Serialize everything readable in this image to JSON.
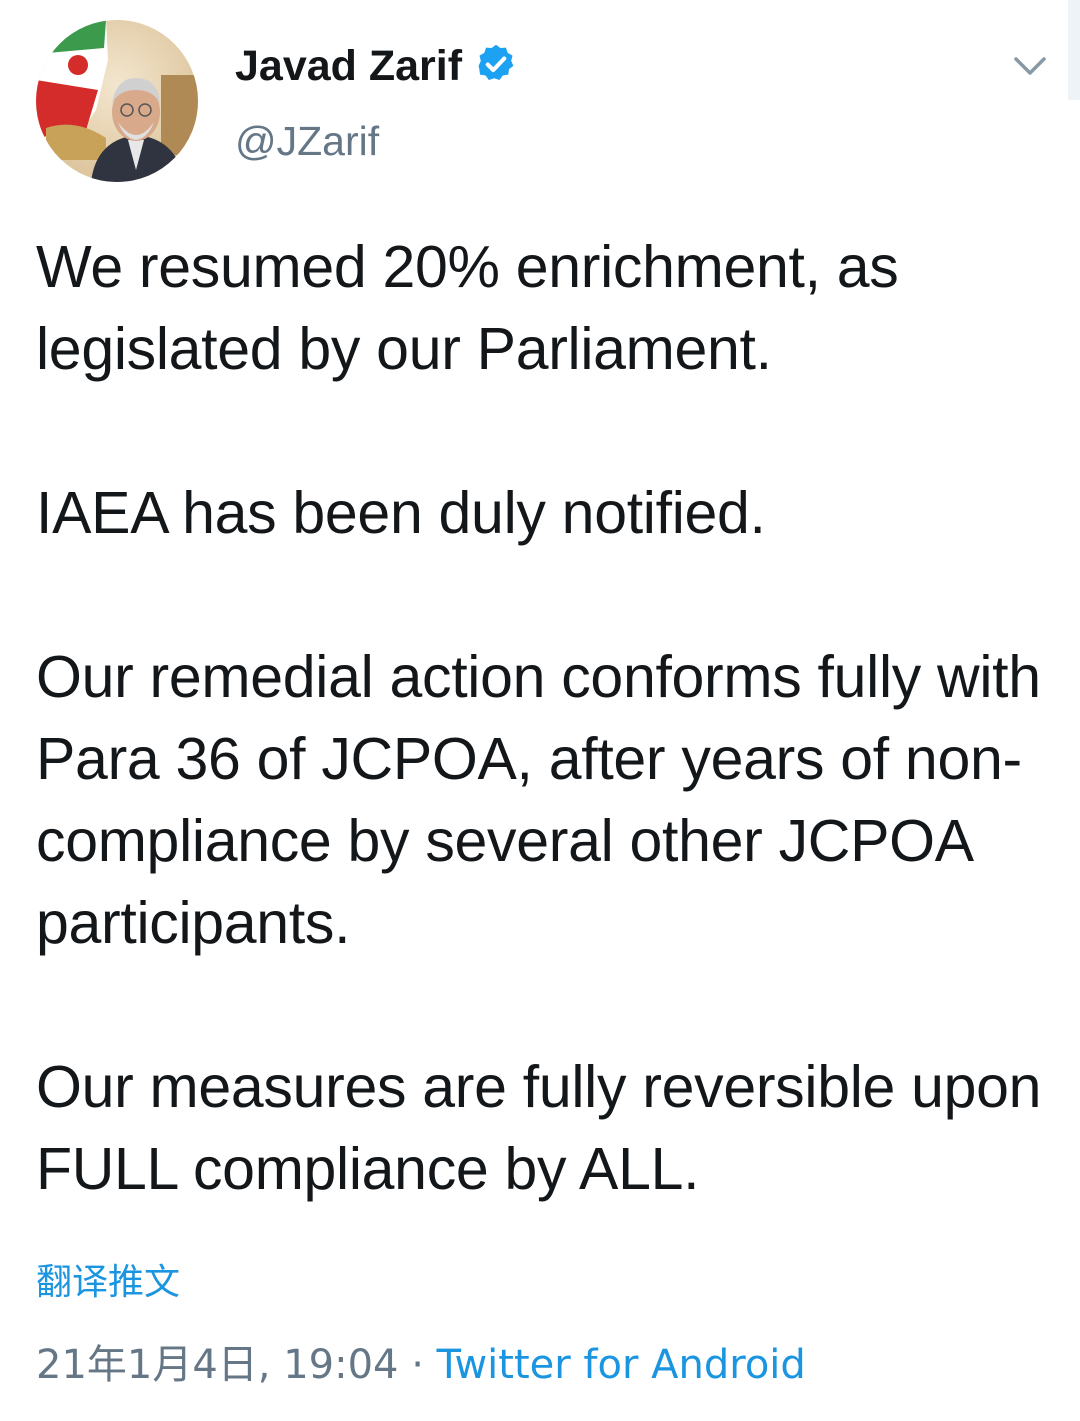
{
  "tweet": {
    "author": {
      "display_name": "Javad Zarif",
      "handle": "@JZarif",
      "verified": true,
      "avatar_icon": "profile-photo"
    },
    "paragraphs": [
      "We resumed 20% enrichment, as legislated by our Parliament.",
      "IAEA has been duly notified.",
      "Our remedial action conforms fully with Para 36 of JCPOA, after years of non-compliance by several other JCPOA participants.",
      "Our measures are fully reversible upon FULL compliance by ALL."
    ],
    "translate_label": "翻译推文",
    "timestamp": "21年1月4日, 19:04",
    "separator": "·",
    "source": "Twitter for Android"
  },
  "icons": {
    "verified": "verified-badge-icon",
    "menu": "chevron-down-icon"
  },
  "colors": {
    "link": "#1b95e0",
    "secondary_text": "#657786",
    "primary_text": "#14171a",
    "verified": "#1da1f2"
  }
}
